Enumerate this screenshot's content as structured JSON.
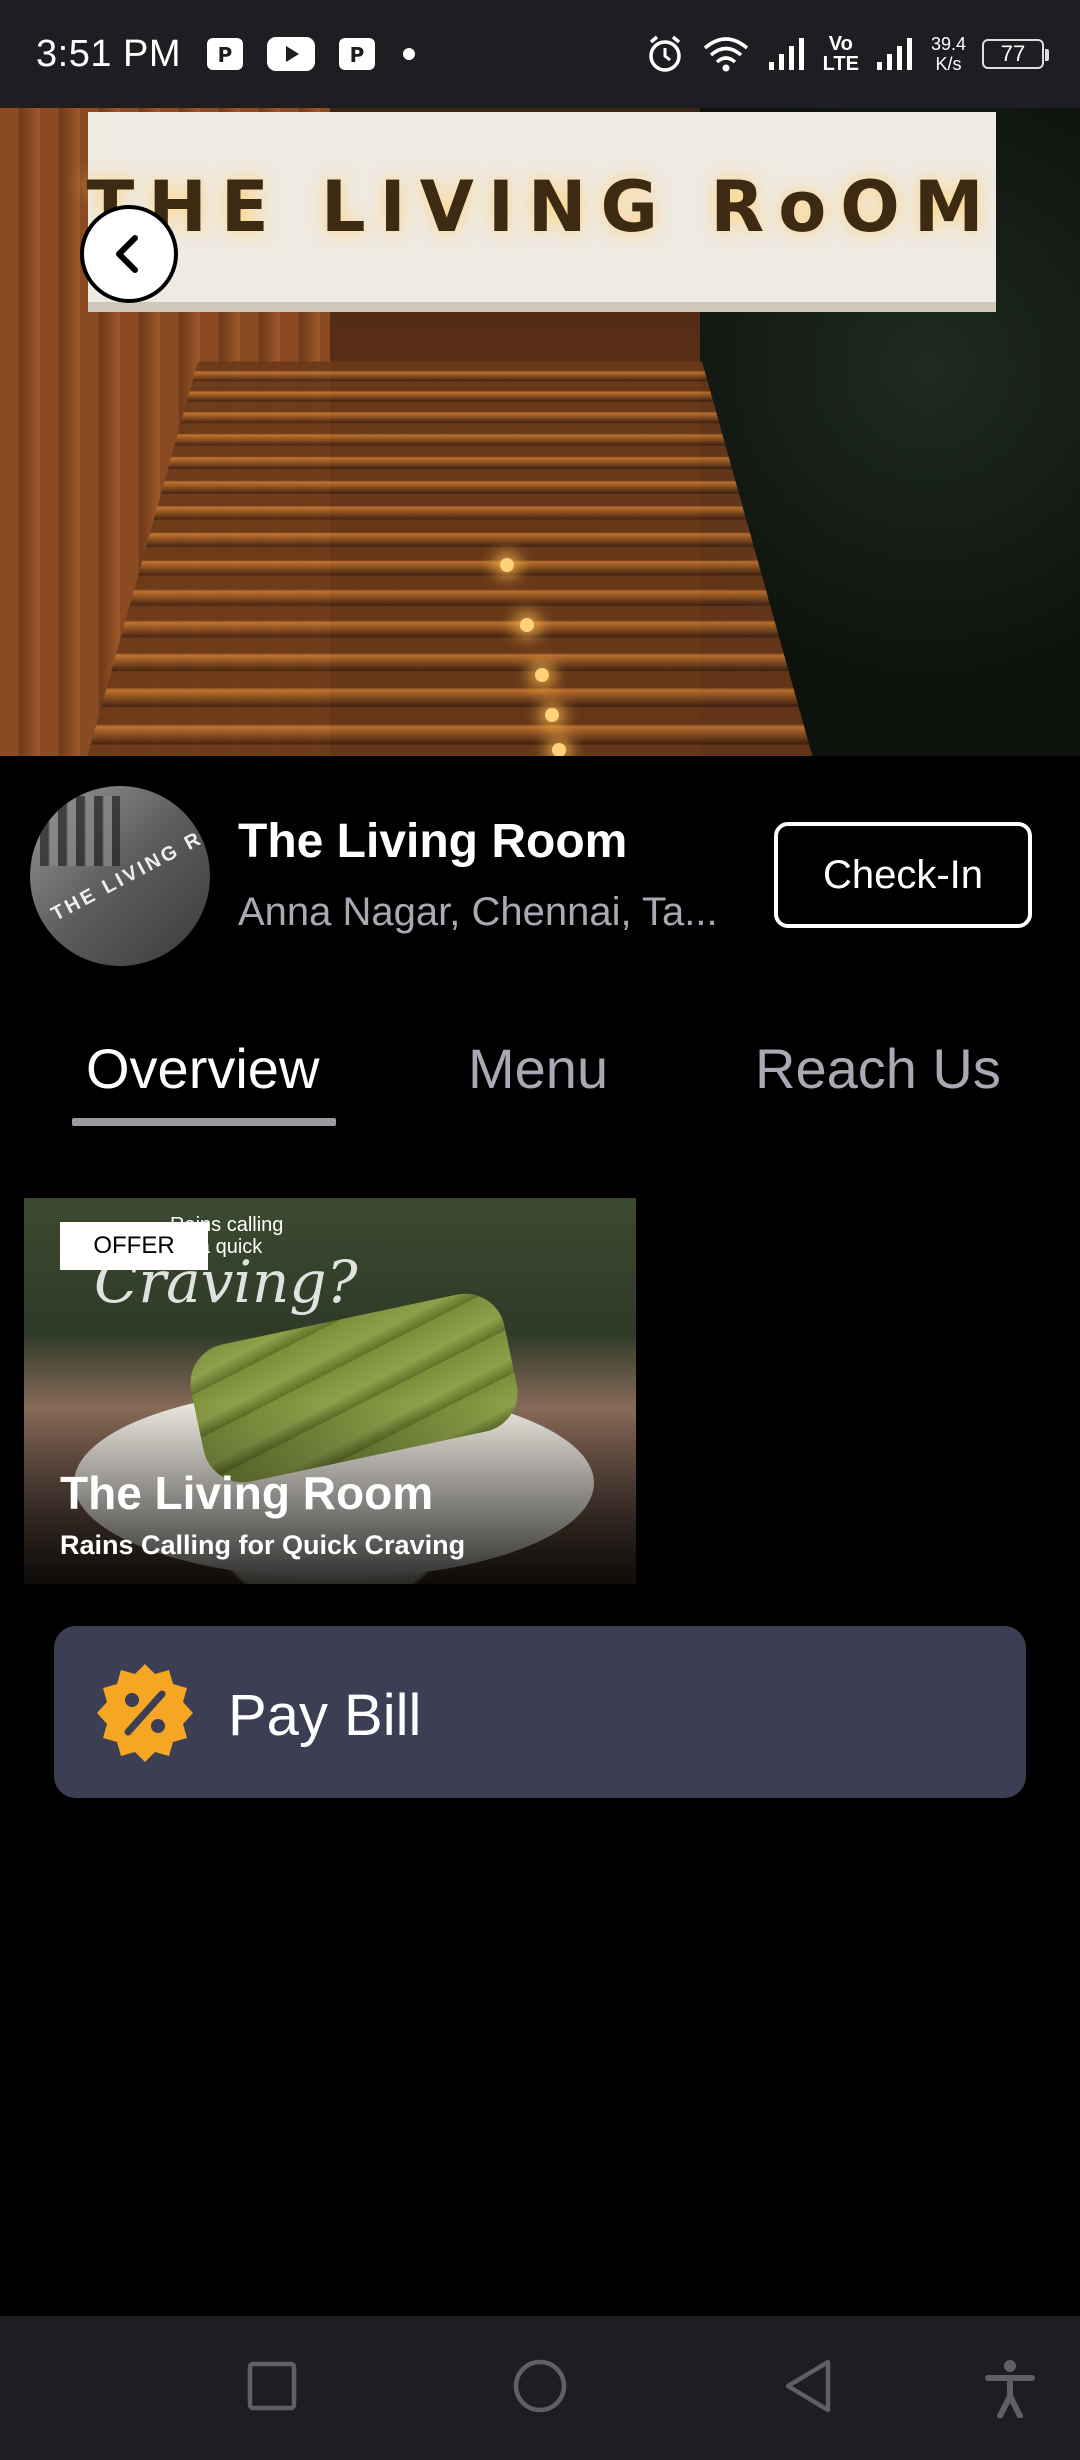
{
  "status_bar": {
    "time": "3:51 PM",
    "net_speed_value": "39.4",
    "net_speed_unit": "K/s",
    "battery": "77",
    "network_label_top": "Vo",
    "network_label_bottom": "LTE",
    "icons": [
      "pdf-icon",
      "youtube-icon",
      "pdf-icon",
      "dot-icon",
      "alarm-icon",
      "wifi-icon",
      "signal-icon",
      "signal-icon",
      "battery-icon"
    ]
  },
  "hero": {
    "sign_text": "THE LIVING RoOM"
  },
  "restaurant": {
    "name": "The Living Room",
    "location": "Anna Nagar, Chennai, Ta...",
    "avatar_text": "THE LIVING ROOM",
    "checkin_label": "Check-In"
  },
  "tabs": [
    {
      "label": "Overview",
      "active": true
    },
    {
      "label": "Menu",
      "active": false
    },
    {
      "label": "Reach Us",
      "active": false
    }
  ],
  "offer": {
    "tag": "OFFER",
    "image_text_small": "Rains calling\nfor a quick",
    "image_text_script": "Craving?",
    "title": "The Living Room",
    "subtitle": "Rains Calling for Quick Craving"
  },
  "paybill": {
    "label": "Pay Bill",
    "icon": "discount-badge-icon",
    "icon_color": "#f5a623"
  },
  "nav_bar": {
    "buttons": [
      "recents-icon",
      "home-icon",
      "back-icon",
      "accessibility-icon"
    ]
  },
  "colors": {
    "background": "#000000",
    "status_bar": "#1e1e22",
    "paybill_bg": "#3c3f54",
    "muted_text": "#a9a9b3"
  }
}
